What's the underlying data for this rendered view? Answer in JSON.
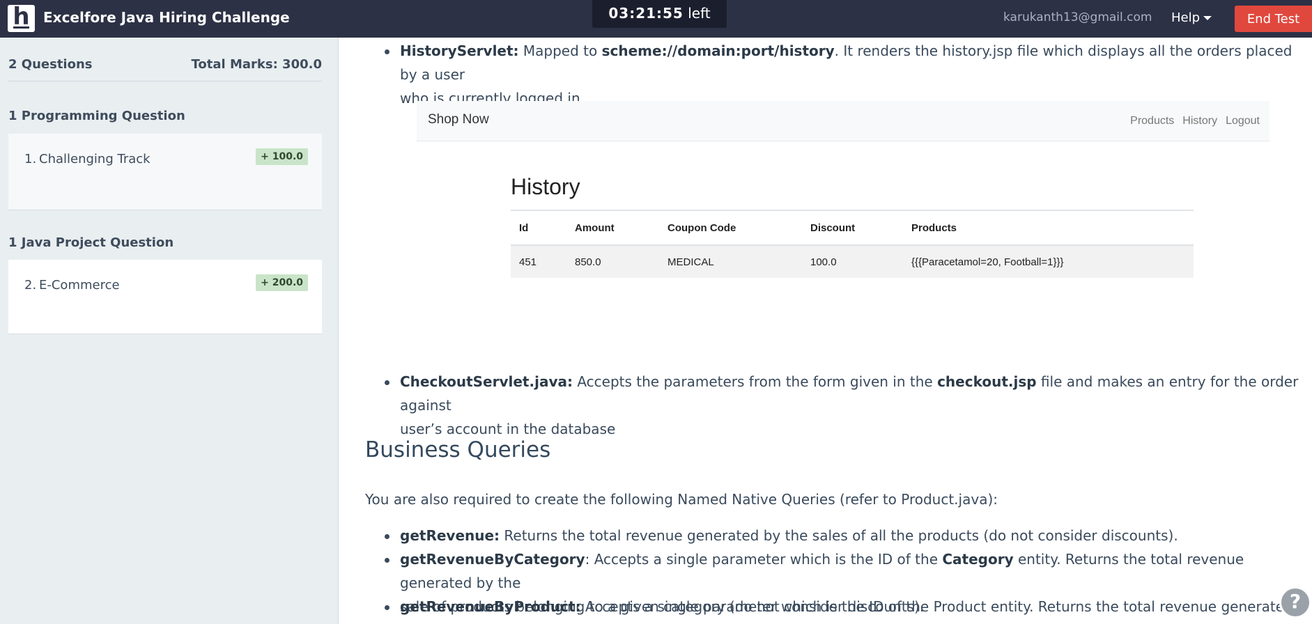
{
  "header": {
    "logo_letter": "h",
    "title": "Excelfore Java Hiring Challenge",
    "timer_value": "03:21:55",
    "timer_suffix": "left",
    "user_email": "karukanth13@gmail.com",
    "help_label": "Help",
    "end_test_label": "End Test"
  },
  "sidebar": {
    "questions_count": "2 Questions",
    "total_marks": "Total Marks: 300.0",
    "sections": [
      {
        "title": "1 Programming Question",
        "items": [
          {
            "number": "1.",
            "name": "Challenging Track",
            "marks": "+ 100.0"
          }
        ]
      },
      {
        "title": "1 Java Project Question",
        "items": [
          {
            "number": "2.",
            "name": "E-Commerce",
            "marks": "+ 200.0"
          }
        ]
      }
    ]
  },
  "content": {
    "history_servlet": {
      "name": "HistoryServlet:",
      "text_1": " Mapped to ",
      "url": "scheme://domain:port/history",
      "text_2": ". It renders the history.jsp file which displays all the orders placed by a user",
      "text_3": "who is currently logged in."
    },
    "screenshot": {
      "brand": "Shop Now",
      "nav_links": [
        "Products",
        "History",
        "Logout"
      ],
      "title": "History",
      "columns": [
        "Id",
        "Amount",
        "Coupon Code",
        "Discount",
        "Products"
      ],
      "rows": [
        [
          "451",
          "850.0",
          "MEDICAL",
          "100.0",
          "{{{Paracetamol=20, Football=1}}}"
        ]
      ]
    },
    "checkout_servlet": {
      "name": "CheckoutServlet.java:",
      "text_1": " Accepts the parameters from the form given in the ",
      "file": "checkout.jsp",
      "text_2": " file and makes an entry for the order against",
      "text_3": "user’s account in the database"
    },
    "business_queries": {
      "heading": "Business Queries",
      "intro": "You are also required to create the following Named Native Queries (refer to Product.java):",
      "get_revenue": {
        "name": "getRevenue:",
        "text": " Returns the total revenue generated by the sales of all the products (do not consider discounts)."
      },
      "get_revenue_by_category": {
        "name": "getRevenueByCategory",
        "text_1": ": Accepts a single parameter which is the ID of the ",
        "entity": "Category",
        "text_2": " entity. Returns the total revenue generated by the",
        "text_3": "sale of products belonging to a given category (do not consider discounts)."
      },
      "get_revenue_by_product": {
        "name": "getRevenueByProduct:",
        "text": " Accepts a single parameter which is the ID of the Product entity. Returns the total revenue generated by the"
      }
    },
    "help_fab": "?"
  }
}
